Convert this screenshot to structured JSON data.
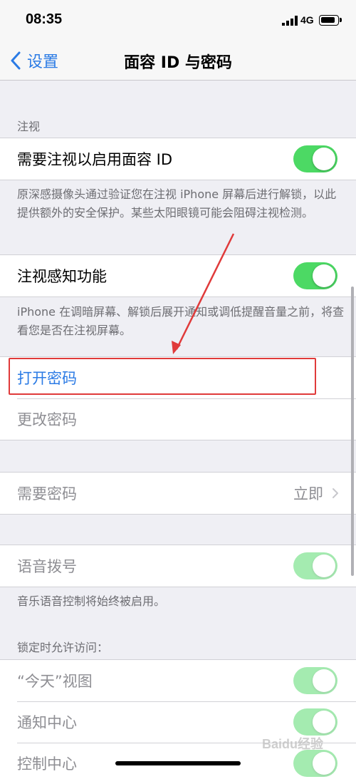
{
  "status": {
    "time": "08:35",
    "network": "4G"
  },
  "nav": {
    "back_label": "设置",
    "title": "面容 ID 与密码"
  },
  "attention": {
    "header": "注视",
    "require_label": "需要注视以启用面容 ID",
    "require_desc": "原深感摄像头通过验证您在注视 iPhone 屏幕后进行解锁，以此提供额外的安全保护。某些太阳眼镜可能会阻碍注视检测。",
    "aware_label": "注视感知功能",
    "aware_desc": "iPhone 在调暗屏幕、解锁后展开通知或调低提醒音量之前，将查看您是否在注视屏幕。"
  },
  "passcode": {
    "turn_on_label": "打开密码",
    "change_label": "更改密码"
  },
  "require_passcode": {
    "label": "需要密码",
    "value": "立即"
  },
  "voice": {
    "label": "语音拨号",
    "desc": "音乐语音控制将始终被启用。"
  },
  "locked_access": {
    "header": "锁定时允许访问：",
    "items": [
      {
        "label": "“今天”视图"
      },
      {
        "label": "通知中心"
      },
      {
        "label": "控制中心"
      }
    ]
  },
  "colors": {
    "accent": "#2b7be5",
    "toggle_on": "#4cd964",
    "highlight": "#e03a3a"
  },
  "watermark": {
    "text": "Baidu经验"
  }
}
